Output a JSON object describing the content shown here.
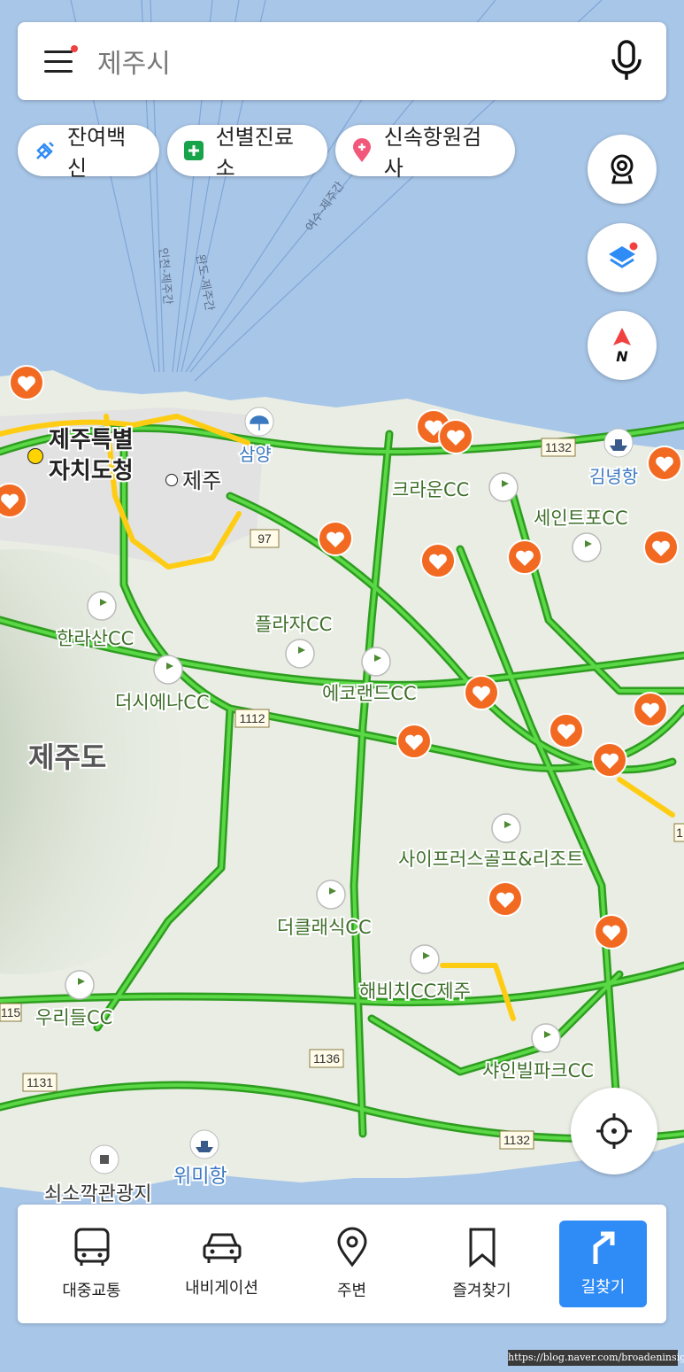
{
  "search": {
    "text": "제주시"
  },
  "chips": [
    {
      "label": "잔여백신",
      "icon": "syringe-icon"
    },
    {
      "label": "선별진료소",
      "icon": "plus-cross-icon"
    },
    {
      "label": "신속항원검사",
      "icon": "map-pin-plus-icon"
    }
  ],
  "map": {
    "place_labels": {
      "jeju_hall": "제주특별\n자치도청",
      "jeju_city": "제주",
      "samyang": "삼양",
      "gimnyeong": "김녕항",
      "jejudo": "제주도",
      "wimi": "위미항",
      "soesokkak": "쇠소깍관광지"
    },
    "ferry_routes": [
      "인천-제주간",
      "완도-제주간",
      "여수-제주간"
    ],
    "golf_courses": [
      "크라운CC",
      "세인트포CC",
      "한라산CC",
      "플라자CC",
      "더시에나CC",
      "에코랜드CC",
      "사이프러스골프&리조트",
      "더클래식CC",
      "우리들CC",
      "해비치CC제주",
      "샤인빌파크CC"
    ],
    "route_numbers": [
      "1132",
      "97",
      "1112",
      "1136",
      "1131",
      "1132",
      "115",
      "1"
    ]
  },
  "bottom_nav": {
    "transit": "대중교통",
    "navigation": "내비게이션",
    "nearby": "주변",
    "favorites": "즐겨찾기",
    "directions": "길찾기"
  },
  "credit": "https://blog.naver.com/broadeninsight",
  "colors": {
    "accent": "#2f8bf6",
    "road_green": "#38c22a",
    "road_yellow": "#ffd21a",
    "marker_orange": "#f26a22",
    "sea": "#a8c6e8"
  }
}
